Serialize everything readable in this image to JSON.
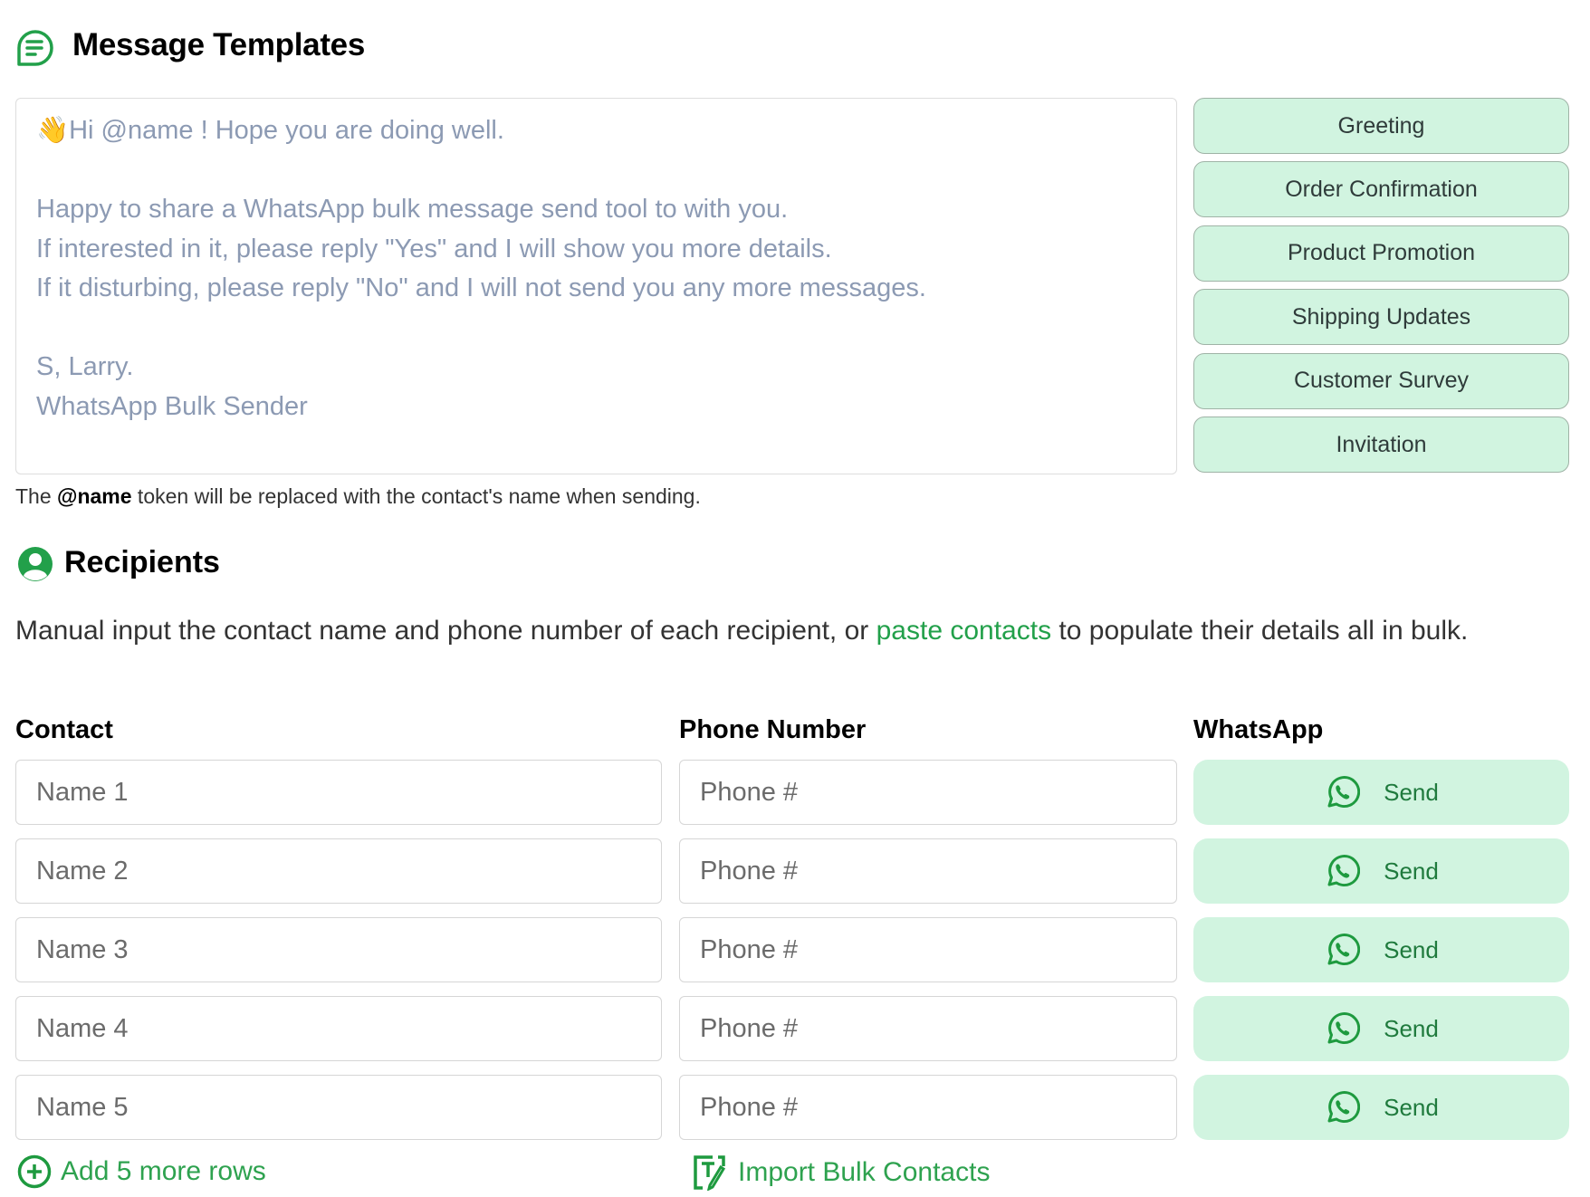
{
  "templates": {
    "title": "Message Templates",
    "message": "👋Hi @name ! Hope you are doing well.\n\nHappy to share a WhatsApp bulk message send tool to with you.\nIf interested in it, please reply \"Yes\" and I will show you more details.\nIf it disturbing, please reply \"No\" and I will not send you any more messages.\n\nS, Larry.\nWhatsApp Bulk Sender",
    "buttons": [
      "Greeting",
      "Order Confirmation",
      "Product Promotion",
      "Shipping Updates",
      "Customer Survey",
      "Invitation"
    ],
    "hint_pre": "The ",
    "hint_token": "@name",
    "hint_post": " token will be replaced with the contact's name when sending."
  },
  "recipients": {
    "title": "Recipients",
    "desc_pre": "Manual input the contact name and phone number of each recipient, or ",
    "desc_link": "paste contacts",
    "desc_post": " to populate their details all in bulk.",
    "columns": [
      "Contact",
      "Phone Number",
      "WhatsApp"
    ],
    "rows": [
      {
        "name_placeholder": "Name 1",
        "phone_placeholder": "Phone #",
        "send": "Send"
      },
      {
        "name_placeholder": "Name 2",
        "phone_placeholder": "Phone #",
        "send": "Send"
      },
      {
        "name_placeholder": "Name 3",
        "phone_placeholder": "Phone #",
        "send": "Send"
      },
      {
        "name_placeholder": "Name 4",
        "phone_placeholder": "Phone #",
        "send": "Send"
      },
      {
        "name_placeholder": "Name 5",
        "phone_placeholder": "Phone #",
        "send": "Send"
      }
    ],
    "add_rows": "Add 5 more rows",
    "import": "Import Bulk Contacts"
  },
  "colors": {
    "accent": "#22a04a",
    "button_bg": "#d1f4e0"
  }
}
